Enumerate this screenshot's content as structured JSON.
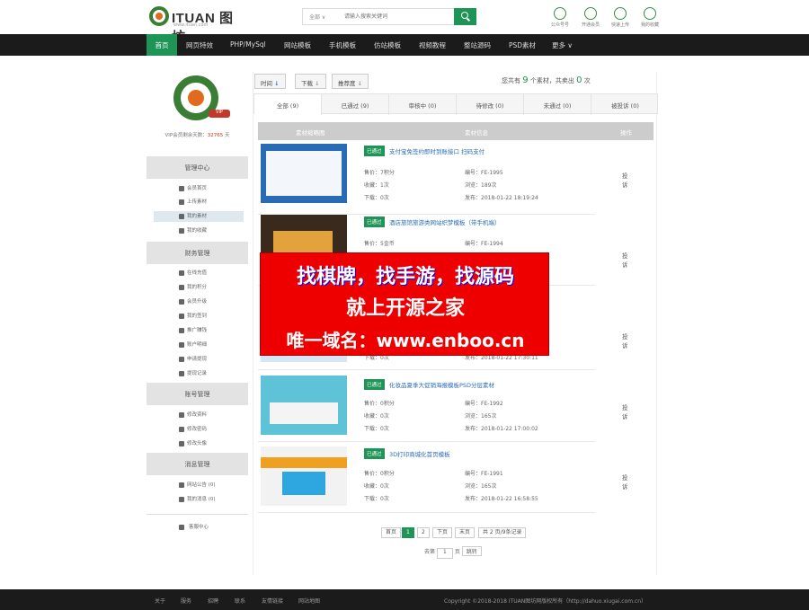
{
  "header": {
    "logo_text": "ITUAN",
    "logo_cn": "图坊",
    "logo_sub": "www.ituan.com",
    "search": {
      "category": "全部",
      "placeholder": "请输入搜索关键词"
    },
    "links": [
      {
        "label": "公众号号",
        "icon": "wechat-icon"
      },
      {
        "label": "开通会员",
        "icon": "crown-icon"
      },
      {
        "label": "快速上传",
        "icon": "upload-icon"
      },
      {
        "label": "我的收藏",
        "icon": "star-icon"
      }
    ]
  },
  "nav": {
    "active": "首页",
    "items": [
      "网页特效",
      "PHP/MySql",
      "网站模板",
      "手机模板",
      "仿站模板",
      "视频教程",
      "整站源码",
      "PSD素材",
      "更多"
    ]
  },
  "sidebar": {
    "vip_badge": "VIP",
    "vip_text": "VIP会员剩余天数：",
    "vip_days": "32765",
    "vip_unit": "天",
    "sections": [
      {
        "title": "管理中心",
        "items": [
          "会员首页",
          "上传素材",
          "我的素材",
          "我的收藏"
        ]
      },
      {
        "title": "财务管理",
        "items": [
          "在线充值",
          "我的积分",
          "会员升级",
          "我的签到",
          "推广赚钱",
          "账户明细",
          "申请提现",
          "提现记录"
        ]
      },
      {
        "title": "账号管理",
        "items": [
          "修改资料",
          "修改密码",
          "修改头像"
        ]
      },
      {
        "title": "消息管理",
        "items": [
          "网站公告 (0)",
          "我的消息 (0)"
        ]
      }
    ],
    "service": "客服中心"
  },
  "toolbar": {
    "sort_time": "时间",
    "sort_download": "下载",
    "sort_recommend": "推荐度",
    "total_prefix": "您共有",
    "total_count": "9",
    "total_mid": "个素材，共卖出",
    "total_sold": "0",
    "total_suffix": "次"
  },
  "tabs": [
    "全部 (9)",
    "已通过 (9)",
    "审核中 (0)",
    "待修改 (0)",
    "未通过 (0)",
    "被投诉 (0)"
  ],
  "table": {
    "headers": [
      "素材缩略图",
      "素材信息",
      "操作"
    ],
    "rows": [
      {
        "status": "已通过",
        "title": "支付宝免签约即时到账接口 扫码支付",
        "price": "售价：7积分",
        "id": "编号：FE-1995",
        "fav": "收藏：1次",
        "views": "浏览：189次",
        "dl": "下载：0次",
        "date": "发布：2018-01-22 18:19:24",
        "action": "投诉"
      },
      {
        "status": "已通过",
        "title": "酒店旅馆旅游类网站织梦模板（带手机端）",
        "price": "售价：5金币",
        "id": "编号：FE-1994",
        "fav": "",
        "views": "",
        "dl": "",
        "date": "",
        "action": "投诉"
      },
      {
        "status": "",
        "title": "",
        "price": "",
        "id": "",
        "fav": "",
        "views": "",
        "dl": "下载：0次",
        "date": "发布：2018-01-22 17:30:11",
        "action": "投诉"
      },
      {
        "status": "已通过",
        "title": "化妆品夏季大促销海报模板PSD分层素材",
        "price": "售价：0积分",
        "id": "编号：FE-1992",
        "fav": "收藏：0次",
        "views": "浏览：165次",
        "dl": "下载：0次",
        "date": "发布：2018-01-22 17:00:02",
        "action": "投诉"
      },
      {
        "status": "已通过",
        "title": "3D打印商城化首页模板",
        "price": "售价：0积分",
        "id": "编号：FE-1991",
        "fav": "收藏：0次",
        "views": "浏览：165次",
        "dl": "下载：0次",
        "date": "发布：2018-01-22 16:58:55",
        "action": "投诉"
      }
    ]
  },
  "overlay": {
    "line1": "找棋牌，找手游，找源码",
    "line2": "就上开源之家",
    "line3": "唯一域名：www.enboo.cn"
  },
  "pagination": {
    "first": "首页",
    "pages": [
      "1",
      "2"
    ],
    "next": "下页",
    "last": "末页",
    "summary": "共 2 页/9条记录",
    "goto_prefix": "去第",
    "goto_value": "1",
    "goto_suffix": "页",
    "goto_btn": "跳转"
  },
  "footer": {
    "links": [
      "关于",
      "服务",
      "招聘",
      "联系",
      "友情链接",
      "网站地图"
    ],
    "copyright": "Copyright ©2018-2018 ITUAN图坊网版权所有（http://dahuo.xiugai.com.cn）"
  }
}
